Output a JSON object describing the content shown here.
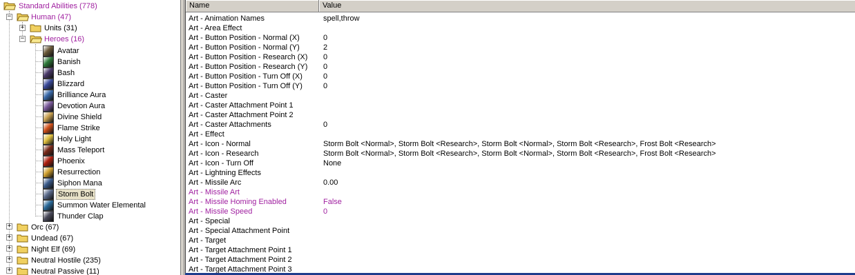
{
  "tree": {
    "root": {
      "label": "Standard Abilities (778)"
    },
    "human": {
      "label": "Human (47)"
    },
    "units": {
      "label": "Units (31)"
    },
    "heroes": {
      "label": "Heroes (16)"
    },
    "abilities": [
      {
        "label": "Avatar",
        "icon": "avatar-icon",
        "color": "#6b5a3a"
      },
      {
        "label": "Banish",
        "icon": "banish-icon",
        "color": "#2f7a3a"
      },
      {
        "label": "Bash",
        "icon": "bash-icon",
        "color": "#4a3a6a"
      },
      {
        "label": "Blizzard",
        "icon": "blizzard-icon",
        "color": "#3a4a9a"
      },
      {
        "label": "Brilliance Aura",
        "icon": "brilliance-aura-icon",
        "color": "#3a6aaa"
      },
      {
        "label": "Devotion Aura",
        "icon": "devotion-aura-icon",
        "color": "#7a5a9a"
      },
      {
        "label": "Divine Shield",
        "icon": "divine-shield-icon",
        "color": "#c8a050"
      },
      {
        "label": "Flame Strike",
        "icon": "flame-strike-icon",
        "color": "#d0501a"
      },
      {
        "label": "Holy Light",
        "icon": "holy-light-icon",
        "color": "#e0c040"
      },
      {
        "label": "Mass Teleport",
        "icon": "mass-teleport-icon",
        "color": "#7a2a1a"
      },
      {
        "label": "Phoenix",
        "icon": "phoenix-icon",
        "color": "#b02010"
      },
      {
        "label": "Resurrection",
        "icon": "resurrection-icon",
        "color": "#d0a030"
      },
      {
        "label": "Siphon Mana",
        "icon": "siphon-mana-icon",
        "color": "#3a5a8a"
      },
      {
        "label": "Storm Bolt",
        "icon": "storm-bolt-icon",
        "color": "#5a6a8a"
      },
      {
        "label": "Summon Water Elemental",
        "icon": "water-elemental-icon",
        "color": "#2a6a9a"
      },
      {
        "label": "Thunder Clap",
        "icon": "thunder-clap-icon",
        "color": "#4a4a5a"
      }
    ],
    "races": [
      {
        "label": "Orc (67)"
      },
      {
        "label": "Undead (67)"
      },
      {
        "label": "Night Elf (69)"
      },
      {
        "label": "Neutral Hostile (235)"
      },
      {
        "label": "Neutral Passive (11)"
      }
    ],
    "selected": "Storm Bolt"
  },
  "grid": {
    "headers": {
      "name": "Name",
      "value": "Value"
    },
    "rows": [
      {
        "name": "Art - Animation Names",
        "value": "spell,throw",
        "modified": false
      },
      {
        "name": "Art - Area Effect",
        "value": "",
        "modified": false
      },
      {
        "name": "Art - Button Position - Normal (X)",
        "value": "0",
        "modified": false
      },
      {
        "name": "Art - Button Position - Normal (Y)",
        "value": "2",
        "modified": false
      },
      {
        "name": "Art - Button Position - Research (X)",
        "value": "0",
        "modified": false
      },
      {
        "name": "Art - Button Position - Research (Y)",
        "value": "0",
        "modified": false
      },
      {
        "name": "Art - Button Position - Turn Off (X)",
        "value": "0",
        "modified": false
      },
      {
        "name": "Art - Button Position - Turn Off (Y)",
        "value": "0",
        "modified": false
      },
      {
        "name": "Art - Caster",
        "value": "",
        "modified": false
      },
      {
        "name": "Art - Caster Attachment Point 1",
        "value": "",
        "modified": false
      },
      {
        "name": "Art - Caster Attachment Point 2",
        "value": "",
        "modified": false
      },
      {
        "name": "Art - Caster Attachments",
        "value": "0",
        "modified": false
      },
      {
        "name": "Art - Effect",
        "value": "",
        "modified": false
      },
      {
        "name": "Art - Icon - Normal",
        "value": "Storm Bolt <Normal>, Storm Bolt <Research>, Storm Bolt <Normal>, Storm Bolt <Research>, Frost Bolt <Research>",
        "modified": false
      },
      {
        "name": "Art - Icon - Research",
        "value": "Storm Bolt <Normal>, Storm Bolt <Research>, Storm Bolt <Normal>, Storm Bolt <Research>, Frost Bolt <Research>",
        "modified": false
      },
      {
        "name": "Art - Icon - Turn Off",
        "value": "None",
        "modified": false
      },
      {
        "name": "Art - Lightning Effects",
        "value": "",
        "modified": false
      },
      {
        "name": "Art - Missile Arc",
        "value": "0.00",
        "modified": false
      },
      {
        "name": "Art - Missile Art",
        "value": "",
        "modified": true
      },
      {
        "name": "Art - Missile Homing Enabled",
        "value": "False",
        "modified": true
      },
      {
        "name": "Art - Missile Speed",
        "value": "0",
        "modified": true
      },
      {
        "name": "Art - Special",
        "value": "",
        "modified": false
      },
      {
        "name": "Art - Special Attachment Point",
        "value": "",
        "modified": false
      },
      {
        "name": "Art - Target",
        "value": "",
        "modified": false
      },
      {
        "name": "Art - Target Attachment Point 1",
        "value": "",
        "modified": false
      },
      {
        "name": "Art - Target Attachment Point 2",
        "value": "",
        "modified": false
      },
      {
        "name": "Art - Target Attachment Point 3",
        "value": "",
        "modified": false
      }
    ]
  },
  "colors": {
    "modified": "#a020a0",
    "folder": "#f0d060"
  }
}
